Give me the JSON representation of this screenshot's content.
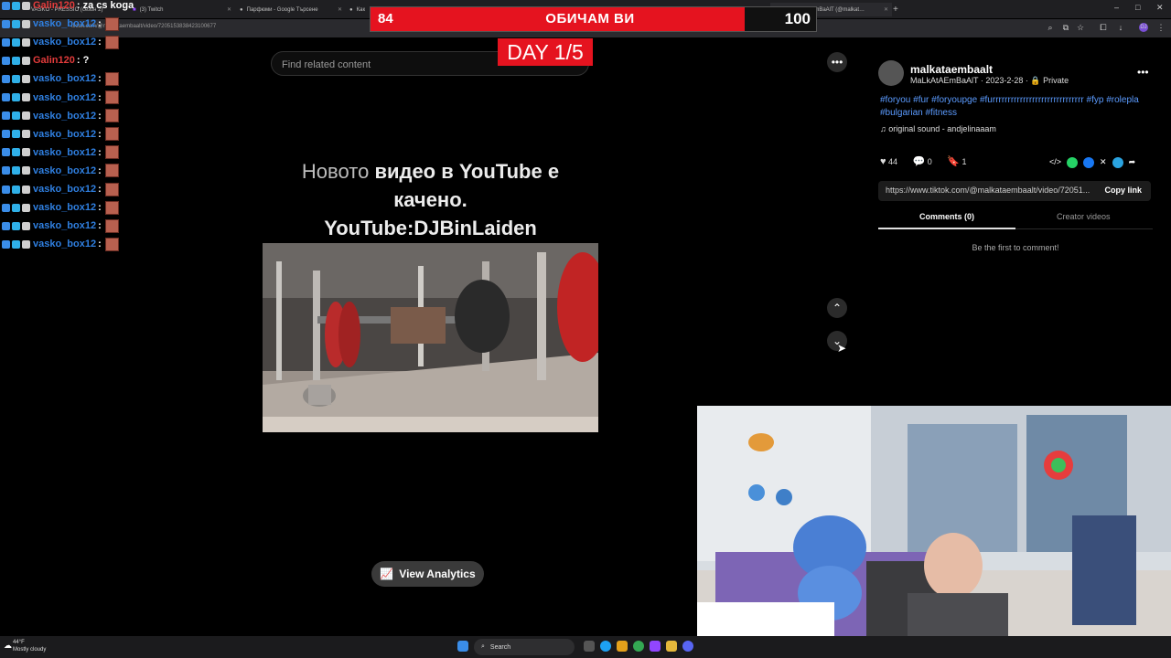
{
  "browser": {
    "tabs": [
      {
        "label": "VASKO - PRESSIO (сезон 2)"
      },
      {
        "label": "(3) Twitch"
      },
      {
        "label": "Парфюми - Google Търсене"
      },
      {
        "label": "Как"
      },
      {
        "label": "(3) MaLkAtAEmBaAlT (@malkat…"
      }
    ],
    "url": "tiktok.com/@malkataembaalt/video/7205153838423100677"
  },
  "tiktok": {
    "search_placeholder": "Find related content",
    "caption_dim": "Новото",
    "caption_rest": "видео в YouTube е качено.",
    "caption_line3": "YouTube:DJBinLaiden",
    "view_analytics": "View Analytics",
    "username": "malkataembaalt",
    "display_name": "MaLkAtAEmBaAlT",
    "date": "2023-2-28",
    "privacy": "Private",
    "hashtags": "#foryou #fur #foryoupge #furrrrrrrrrrrrrrrrrrrrrrrrrrrrrr #fyp #rolepla #bulgarian #fitness",
    "sound": "original sound - andjelinaaam",
    "likes": "44",
    "comments": "0",
    "saves": "1",
    "link": "https://www.tiktok.com/@malkataembaalt/video/72051...",
    "copy_link": "Copy link",
    "tab_comments": "Comments (0)",
    "tab_creator": "Creator videos",
    "empty_comments": "Be the first to comment!"
  },
  "overlay": {
    "goal_left": "84",
    "goal_text": "ОБИЧАМ ВИ",
    "goal_right": "100",
    "goal_fraction": 0.84,
    "day": "DAY 1/5"
  },
  "chat": [
    {
      "name": "Galin120",
      "msg": ": za cs koga",
      "color": "#e23b3b",
      "emote": false
    },
    {
      "name": "vasko_box12",
      "msg": ":",
      "color": "#2f7fe0",
      "emote": true
    },
    {
      "name": "vasko_box12",
      "msg": ":",
      "color": "#2f7fe0",
      "emote": true
    },
    {
      "name": "Galin120",
      "msg": ": ?",
      "color": "#e23b3b",
      "emote": false
    },
    {
      "name": "vasko_box12",
      "msg": ":",
      "color": "#2f7fe0",
      "emote": true
    },
    {
      "name": "vasko_box12",
      "msg": ":",
      "color": "#2f7fe0",
      "emote": true
    },
    {
      "name": "vasko_box12",
      "msg": ":",
      "color": "#2f7fe0",
      "emote": true
    },
    {
      "name": "vasko_box12",
      "msg": ":",
      "color": "#2f7fe0",
      "emote": true
    },
    {
      "name": "vasko_box12",
      "msg": ":",
      "color": "#2f7fe0",
      "emote": true
    },
    {
      "name": "vasko_box12",
      "msg": ":",
      "color": "#2f7fe0",
      "emote": true
    },
    {
      "name": "vasko_box12",
      "msg": ":",
      "color": "#2f7fe0",
      "emote": true
    },
    {
      "name": "vasko_box12",
      "msg": ":",
      "color": "#2f7fe0",
      "emote": true
    },
    {
      "name": "vasko_box12",
      "msg": ":",
      "color": "#2f7fe0",
      "emote": true
    },
    {
      "name": "vasko_box12",
      "msg": ":",
      "color": "#2f7fe0",
      "emote": true
    }
  ],
  "taskbar": {
    "temp": "44°F",
    "weather": "Mostly cloudy",
    "search": "Search"
  },
  "colors": {
    "accent_red": "#e5131f",
    "hashtag_blue": "#5b9bff"
  }
}
